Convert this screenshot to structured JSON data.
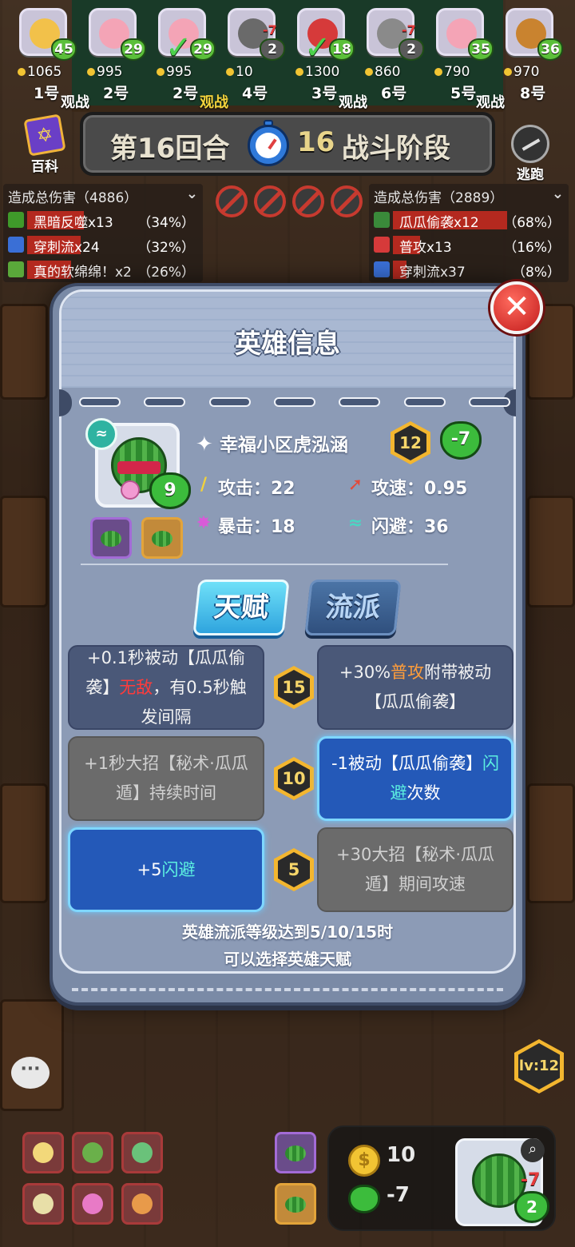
{
  "players": [
    {
      "hp": "45",
      "gold": "1065",
      "rank": "1号",
      "delta": "",
      "checked": false,
      "face": "#f2c14a"
    },
    {
      "hp": "29",
      "gold": "995",
      "rank": "2号",
      "delta": "",
      "checked": false,
      "face": "#f4a4b6"
    },
    {
      "hp": "29",
      "gold": "995",
      "rank": "2号",
      "delta": "",
      "checked": true,
      "face": "#f4a4b6"
    },
    {
      "hp": "2",
      "gold": "10",
      "rank": "4号",
      "delta": "-7",
      "checked": false,
      "face": "#6a6a6a"
    },
    {
      "hp": "18",
      "gold": "1300",
      "rank": "3号",
      "delta": "",
      "checked": true,
      "face": "#d63a3a"
    },
    {
      "hp": "2",
      "gold": "860",
      "rank": "6号",
      "delta": "-7",
      "checked": false,
      "face": "#8a8a8a"
    },
    {
      "hp": "35",
      "gold": "790",
      "rank": "5号",
      "delta": "",
      "checked": false,
      "face": "#f4a4b6"
    },
    {
      "hp": "36",
      "gold": "970",
      "rank": "8号",
      "delta": "",
      "checked": false,
      "face": "#c9832f"
    }
  ],
  "watch_labels": [
    "观战",
    "观战",
    "观战",
    "观战"
  ],
  "encyclopedia_label": "百科",
  "round": {
    "label": "第16回合",
    "timer": "16",
    "phase": "战斗阶段"
  },
  "escape_label": "逃跑",
  "damage_left": {
    "title": "造成总伤害（4886）",
    "rows": [
      {
        "name": "黑暗反噬x13",
        "pct": "（34%）",
        "fill": 0.34,
        "icon_color": "#3f9a2a"
      },
      {
        "name": "穿刺流x24",
        "pct": "（32%）",
        "fill": 0.32,
        "icon_color": "#3a6fd6"
      },
      {
        "name": "真的软绵绵！x2",
        "pct": "（26%）",
        "fill": 0.26,
        "icon_color": "#5aa83a"
      }
    ]
  },
  "damage_right": {
    "title": "造成总伤害（2889）",
    "rows": [
      {
        "name": "瓜瓜偷袭x12",
        "pct": "（68%）",
        "fill": 0.68,
        "icon_color": "#3a8a3a"
      },
      {
        "name": "普攻x13",
        "pct": "（16%）",
        "fill": 0.16,
        "icon_color": "#d63a3a"
      },
      {
        "name": "穿刺流x37",
        "pct": "（8%）",
        "fill": 0.08,
        "icon_color": "#3a6fd6"
      }
    ]
  },
  "modal": {
    "title": "英雄信息",
    "close_icon": "✕",
    "hero": {
      "name": "幸福小区虎泓涵",
      "level": "12",
      "hp_change": "-7",
      "heart_value": "9"
    },
    "stats": {
      "attack": "攻击：22",
      "attack_speed": "攻速：0.95",
      "crit": "暴击：18",
      "dodge": "闪避：36"
    },
    "tabs": {
      "talent": "天赋",
      "school": "流派"
    },
    "talents": {
      "t15_left_a": "+0.1秒被动【瓜瓜偷袭】",
      "t15_left_hl": "无敌",
      "t15_left_b": "，有0.5秒触发间隔",
      "t15_right_a": "+30%",
      "t15_right_hl": "普攻",
      "t15_right_b": "附带被动【瓜瓜偷袭】",
      "t10_left": "+1秒大招【秘术·瓜瓜遁】持续时间",
      "t10_right_a": "-1被动【瓜瓜偷袭】",
      "t10_right_hl": "闪避",
      "t10_right_b": "次数",
      "t5_left_a": "+5",
      "t5_left_hl": "闪避",
      "t5_right": "+30大招【秘术·瓜瓜遁】期间攻速"
    },
    "tiers": [
      "15",
      "10",
      "5"
    ],
    "footer_line1": "英雄流派等级达到5/10/15时",
    "footer_line2": "可以选择英雄天赋"
  },
  "bottom": {
    "level": "lv:12",
    "gold": "10",
    "hp": "-7",
    "bench_hp": "2",
    "bench_delta": "-7",
    "coin_symbol": "$",
    "chat_icon": "···",
    "search_icon": "⌕"
  }
}
